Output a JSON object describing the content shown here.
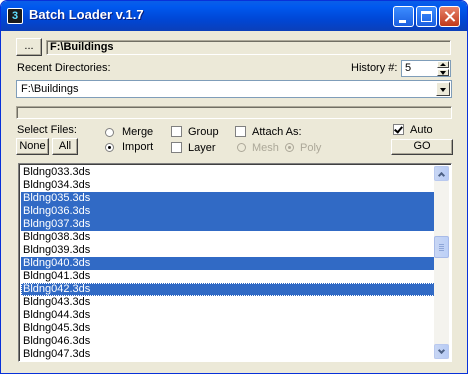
{
  "window": {
    "title": "Batch Loader v.1.7",
    "app_icon_glyph": "3"
  },
  "path_row": {
    "browse_label": "...",
    "current_path": "F:\\Buildings"
  },
  "recent": {
    "label": "Recent Directories:",
    "history_label": "History #:",
    "history_value": "5",
    "selected_directory": "F:\\Buildings"
  },
  "select_files": {
    "label": "Select Files:",
    "none_label": "None",
    "all_label": "All"
  },
  "mode": {
    "merge_label": "Merge",
    "import_label": "Import",
    "selected": "Import"
  },
  "options": {
    "group_label": "Group",
    "layer_label": "Layer",
    "attach_as_label": "Attach As:",
    "mesh_label": "Mesh",
    "poly_label": "Poly",
    "group_checked": false,
    "layer_checked": false,
    "attach_checked": false,
    "attach_type": "Poly"
  },
  "go": {
    "auto_label": "Auto",
    "auto_checked": true,
    "go_label": "GO"
  },
  "files": [
    {
      "name": "Bldng033.3ds",
      "selected": false
    },
    {
      "name": "Bldng034.3ds",
      "selected": false
    },
    {
      "name": "Bldng035.3ds",
      "selected": true
    },
    {
      "name": "Bldng036.3ds",
      "selected": true
    },
    {
      "name": "Bldng037.3ds",
      "selected": true
    },
    {
      "name": "Bldng038.3ds",
      "selected": false
    },
    {
      "name": "Bldng039.3ds",
      "selected": false
    },
    {
      "name": "Bldng040.3ds",
      "selected": true
    },
    {
      "name": "Bldng041.3ds",
      "selected": false
    },
    {
      "name": "Bldng042.3ds",
      "selected": true,
      "focused": true
    },
    {
      "name": "Bldng043.3ds",
      "selected": false
    },
    {
      "name": "Bldng044.3ds",
      "selected": false
    },
    {
      "name": "Bldng045.3ds",
      "selected": false
    },
    {
      "name": "Bldng046.3ds",
      "selected": false
    },
    {
      "name": "Bldng047.3ds",
      "selected": false
    }
  ],
  "colors": {
    "titlebar": "#0058ee",
    "selection": "#316ac5",
    "face": "#ece9d8"
  }
}
